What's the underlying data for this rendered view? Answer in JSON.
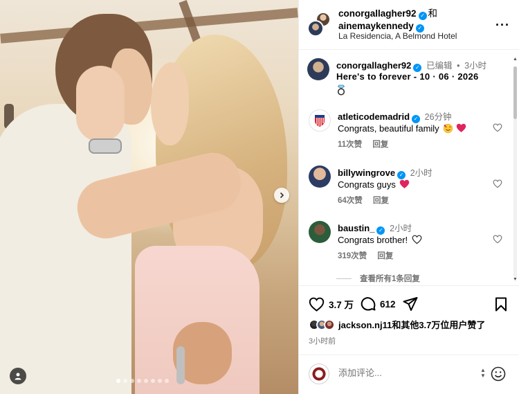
{
  "post": {
    "author": "conorgallagher92",
    "conjunction": "和",
    "coauthor": "ainemaykennedy",
    "location": "La Residencia, A Belmond Hotel",
    "more_icon": "more-horizontal-icon"
  },
  "caption": {
    "user": "conorgallagher92",
    "edited": "已编辑",
    "separator": "•",
    "time": "3小时",
    "text": "Here's to forever - 10 · 06 · 2026",
    "emoji": "ring"
  },
  "comments": [
    {
      "user": "atleticodemadrid",
      "verified": true,
      "time": "26分钟",
      "text": "Congrats, beautiful family",
      "emojis": [
        "smiling-face-with-hearts",
        "red-heart"
      ],
      "likes": "11次赞",
      "reply": "回复"
    },
    {
      "user": "billywingrove",
      "verified": true,
      "time": "2小时",
      "text": "Congrats guys",
      "emojis": [
        "red-heart"
      ],
      "likes": "64次赞",
      "reply": "回复"
    },
    {
      "user": "baustin_",
      "verified": true,
      "time": "2小时",
      "text": "Congrats brother!",
      "emojis": [
        "white-heart"
      ],
      "likes": "319次赞",
      "reply": "回复"
    }
  ],
  "view_replies": "查看所有1条回复",
  "actions": {
    "likes_count": "3.7 万",
    "comments_count": "612"
  },
  "likes_line": {
    "user": "jackson.nj11",
    "text": "和其他3.7万位用户赞了"
  },
  "post_time": "3小时前",
  "add_comment": {
    "placeholder": "添加评论..."
  },
  "carousel": {
    "dots": 8,
    "active_index": 0
  },
  "colors": {
    "verified": "#0095f6",
    "heart_red": "#e0245e",
    "muted": "#737373"
  }
}
